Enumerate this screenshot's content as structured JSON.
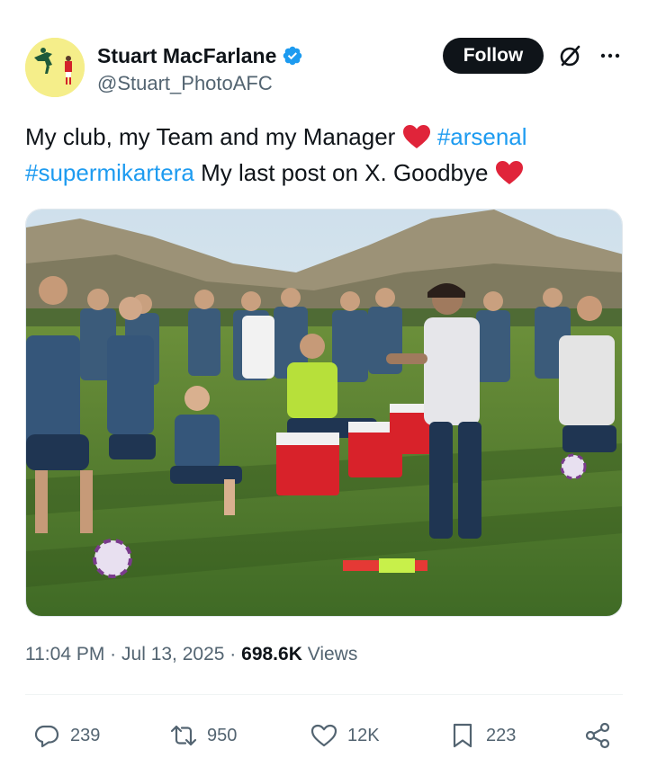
{
  "author": {
    "display_name": "Stuart MacFarlane",
    "handle": "@Stuart_PhotoAFC",
    "verified": true,
    "verified_color": "#1d9bf0"
  },
  "header": {
    "follow_label": "Follow",
    "grok_icon": "grok-slash-circle-icon",
    "more_icon": "more-dots-icon"
  },
  "tweet": {
    "text_part1": "My club, my Team and my Manager ",
    "hashtag1": "#arsenal",
    "hashtag2": "#supermikartera",
    "text_part2": " My last post on X. Goodbye ",
    "emoji": "red-heart",
    "hashtag_color": "#1d9bf0"
  },
  "media": {
    "image": "football-team-training-photo"
  },
  "meta": {
    "time": "11:04 PM",
    "separator": "·",
    "date": "Jul 13, 2025",
    "views_count": "698.6K",
    "views_label": "Views"
  },
  "actions": {
    "replies": "239",
    "reposts": "950",
    "likes": "12K",
    "bookmarks": "223",
    "icon_color": "#536471"
  }
}
